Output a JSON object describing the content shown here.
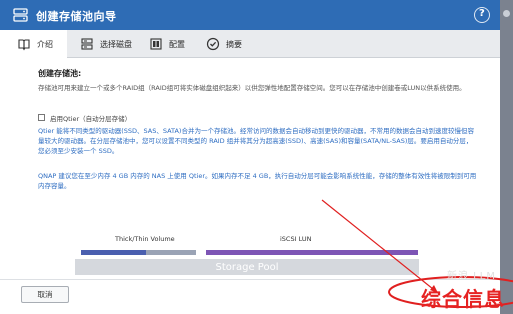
{
  "window": {
    "title": "创建存储池向导",
    "help_icon": "?",
    "accent": "#2e6cb5"
  },
  "steps": [
    {
      "label": "介绍",
      "icon": "guide-icon",
      "active": true
    },
    {
      "label": "选择磁盘",
      "icon": "disk-icon",
      "active": false
    },
    {
      "label": "配置",
      "icon": "config-icon",
      "active": false
    },
    {
      "label": "摘要",
      "icon": "check-circle-icon",
      "active": false
    }
  ],
  "content": {
    "heading": "创建存储池:",
    "intro": "存储池可用来建立一个或多个RAID组（RAID组可将实体磁盘组织起来）以供您弹性地配置存储空间。您可以在存储池中创建卷或LUN以供系统使用。",
    "qtier_checkbox_label": "启用Qtier（自动分层存储）",
    "qtier_checked": false,
    "qtier_desc": "Qtier 能将不同类型的驱动器(SSD、SAS、SATA)合并为一个存储池。经常访问的数据会自动移动到更快的驱动器，不常用的数据会自动到速度较慢但容量较大的驱动器。在分层存储池中，您可以设置不同类型的 RAID 组并将其分为超高速(SSD)、高速(SAS)和容量(SATA/NL-SAS)层。要启用自动分层，您必须至少安装一个 SSD。",
    "qtier_note": "QNAP 建议您在至少内存 4 GB 内存的 NAS 上使用 Qtier。如果内存不足 4 GB，执行自动分层可能会影响系统性能，存储的整体有效性将被限制到可用内存容量。",
    "diagram": {
      "volume_label": "Thick/Thin Volume",
      "lun_label": "iSCSI LUN",
      "pool_label": "Storage Pool"
    }
  },
  "footer": {
    "cancel_label": "取消"
  },
  "overlay": {
    "small_text": "新浪 LLM",
    "stamp_text": "综合信息"
  }
}
